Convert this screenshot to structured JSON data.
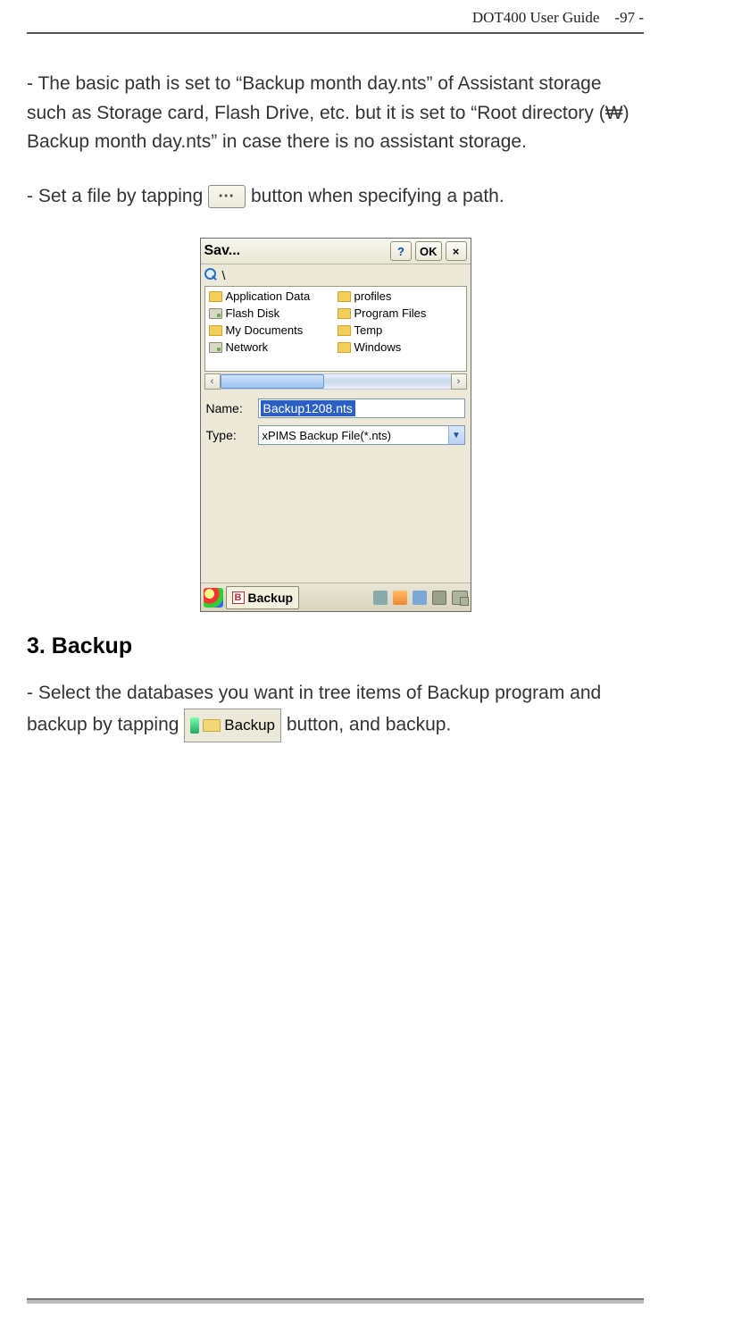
{
  "header": {
    "doc_title": "DOT400 User Guide",
    "page_no": "-97 -"
  },
  "para1": "- The basic path is set to “Backup month day.nts” of Assistant storage such as Storage card, Flash Drive, etc. but it is set to “Root directory (₩) Backup month day.nts” in case there is no assistant storage.",
  "para2_pre": "- Set a file by tapping ",
  "para2_btn": "⋯",
  "para2_post": " button when specifying a path.",
  "dialog": {
    "title": "Sav...",
    "help": "?",
    "ok": "OK",
    "close": "×",
    "path": "\\",
    "files_left": [
      {
        "label": "Application Data",
        "icon": "folder"
      },
      {
        "label": "Flash Disk",
        "icon": "drive"
      },
      {
        "label": "My Documents",
        "icon": "folder"
      },
      {
        "label": "Network",
        "icon": "drive"
      }
    ],
    "files_right": [
      {
        "label": "profiles",
        "icon": "folder"
      },
      {
        "label": "Program Files",
        "icon": "folder"
      },
      {
        "label": "Temp",
        "icon": "folder"
      },
      {
        "label": "Windows",
        "icon": "folder"
      }
    ],
    "scroll_left": "‹",
    "scroll_right": "›",
    "name_label": "Name:",
    "name_value": "Backup1208.nts",
    "type_label": "Type:",
    "type_value": "xPIMS Backup File(*.nts)",
    "taskbar": {
      "button_badge": "B",
      "button_label": "Backup"
    }
  },
  "heading": "3. Backup",
  "para3_pre": "- Select the databases you want in tree items of Backup program and backup by tapping ",
  "para3_btn": "Backup",
  "para3_post": " button, and backup."
}
